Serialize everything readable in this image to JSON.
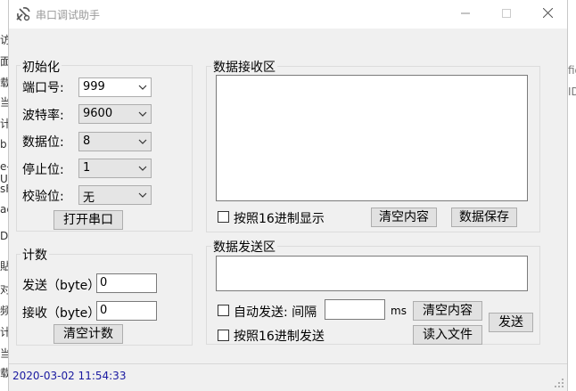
{
  "window": {
    "title": "串口调试助手"
  },
  "init": {
    "legend": "初始化",
    "port_label": "端口号:",
    "port_value": "999",
    "baud_label": "波特率:",
    "baud_value": "9600",
    "databits_label": "数据位:",
    "databits_value": "8",
    "stopbits_label": "停止位:",
    "stopbits_value": "1",
    "parity_label": "校验位:",
    "parity_value": "无",
    "open_button": "打开串口"
  },
  "count": {
    "legend": "计数",
    "sent_label": "发送（byte）",
    "sent_value": "0",
    "recv_label": "接收（byte）",
    "recv_value": "0",
    "clear_button": "清空计数"
  },
  "receive": {
    "legend": "数据接收区",
    "hex_display_label": "按照16进制显示",
    "clear_button": "清空内容",
    "save_button": "数据保存"
  },
  "send": {
    "legend": "数据发送区",
    "auto_send_label": "自动发送: 间隔",
    "interval_unit": "ms",
    "clear_button": "清空内容",
    "send_button": "发送",
    "hex_send_label": "按照16进制发送",
    "load_file_button": "读入文件"
  },
  "status": {
    "datetime": "2020-03-02 11:54:33"
  },
  "background": {
    "left_chars": [
      "访",
      "面",
      "载",
      "当",
      "计",
      "b",
      "e-U",
      "sF",
      "ac",
      "D",
      "貼",
      "对",
      "频",
      "计",
      "当",
      "载"
    ],
    "right_chars": [
      "fig",
      "ID"
    ]
  }
}
